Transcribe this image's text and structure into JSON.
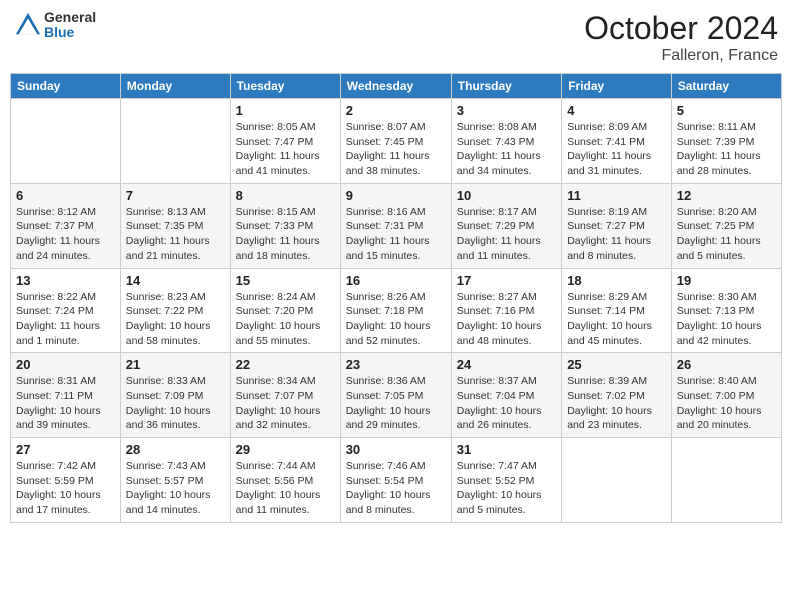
{
  "header": {
    "logo": {
      "general": "General",
      "blue": "Blue"
    },
    "title": "October 2024",
    "location": "Falleron, France"
  },
  "days_of_week": [
    "Sunday",
    "Monday",
    "Tuesday",
    "Wednesday",
    "Thursday",
    "Friday",
    "Saturday"
  ],
  "weeks": [
    [
      {
        "day": "",
        "sunrise": "",
        "sunset": "",
        "daylight": ""
      },
      {
        "day": "",
        "sunrise": "",
        "sunset": "",
        "daylight": ""
      },
      {
        "day": "1",
        "sunrise": "Sunrise: 8:05 AM",
        "sunset": "Sunset: 7:47 PM",
        "daylight": "Daylight: 11 hours and 41 minutes."
      },
      {
        "day": "2",
        "sunrise": "Sunrise: 8:07 AM",
        "sunset": "Sunset: 7:45 PM",
        "daylight": "Daylight: 11 hours and 38 minutes."
      },
      {
        "day": "3",
        "sunrise": "Sunrise: 8:08 AM",
        "sunset": "Sunset: 7:43 PM",
        "daylight": "Daylight: 11 hours and 34 minutes."
      },
      {
        "day": "4",
        "sunrise": "Sunrise: 8:09 AM",
        "sunset": "Sunset: 7:41 PM",
        "daylight": "Daylight: 11 hours and 31 minutes."
      },
      {
        "day": "5",
        "sunrise": "Sunrise: 8:11 AM",
        "sunset": "Sunset: 7:39 PM",
        "daylight": "Daylight: 11 hours and 28 minutes."
      }
    ],
    [
      {
        "day": "6",
        "sunrise": "Sunrise: 8:12 AM",
        "sunset": "Sunset: 7:37 PM",
        "daylight": "Daylight: 11 hours and 24 minutes."
      },
      {
        "day": "7",
        "sunrise": "Sunrise: 8:13 AM",
        "sunset": "Sunset: 7:35 PM",
        "daylight": "Daylight: 11 hours and 21 minutes."
      },
      {
        "day": "8",
        "sunrise": "Sunrise: 8:15 AM",
        "sunset": "Sunset: 7:33 PM",
        "daylight": "Daylight: 11 hours and 18 minutes."
      },
      {
        "day": "9",
        "sunrise": "Sunrise: 8:16 AM",
        "sunset": "Sunset: 7:31 PM",
        "daylight": "Daylight: 11 hours and 15 minutes."
      },
      {
        "day": "10",
        "sunrise": "Sunrise: 8:17 AM",
        "sunset": "Sunset: 7:29 PM",
        "daylight": "Daylight: 11 hours and 11 minutes."
      },
      {
        "day": "11",
        "sunrise": "Sunrise: 8:19 AM",
        "sunset": "Sunset: 7:27 PM",
        "daylight": "Daylight: 11 hours and 8 minutes."
      },
      {
        "day": "12",
        "sunrise": "Sunrise: 8:20 AM",
        "sunset": "Sunset: 7:25 PM",
        "daylight": "Daylight: 11 hours and 5 minutes."
      }
    ],
    [
      {
        "day": "13",
        "sunrise": "Sunrise: 8:22 AM",
        "sunset": "Sunset: 7:24 PM",
        "daylight": "Daylight: 11 hours and 1 minute."
      },
      {
        "day": "14",
        "sunrise": "Sunrise: 8:23 AM",
        "sunset": "Sunset: 7:22 PM",
        "daylight": "Daylight: 10 hours and 58 minutes."
      },
      {
        "day": "15",
        "sunrise": "Sunrise: 8:24 AM",
        "sunset": "Sunset: 7:20 PM",
        "daylight": "Daylight: 10 hours and 55 minutes."
      },
      {
        "day": "16",
        "sunrise": "Sunrise: 8:26 AM",
        "sunset": "Sunset: 7:18 PM",
        "daylight": "Daylight: 10 hours and 52 minutes."
      },
      {
        "day": "17",
        "sunrise": "Sunrise: 8:27 AM",
        "sunset": "Sunset: 7:16 PM",
        "daylight": "Daylight: 10 hours and 48 minutes."
      },
      {
        "day": "18",
        "sunrise": "Sunrise: 8:29 AM",
        "sunset": "Sunset: 7:14 PM",
        "daylight": "Daylight: 10 hours and 45 minutes."
      },
      {
        "day": "19",
        "sunrise": "Sunrise: 8:30 AM",
        "sunset": "Sunset: 7:13 PM",
        "daylight": "Daylight: 10 hours and 42 minutes."
      }
    ],
    [
      {
        "day": "20",
        "sunrise": "Sunrise: 8:31 AM",
        "sunset": "Sunset: 7:11 PM",
        "daylight": "Daylight: 10 hours and 39 minutes."
      },
      {
        "day": "21",
        "sunrise": "Sunrise: 8:33 AM",
        "sunset": "Sunset: 7:09 PM",
        "daylight": "Daylight: 10 hours and 36 minutes."
      },
      {
        "day": "22",
        "sunrise": "Sunrise: 8:34 AM",
        "sunset": "Sunset: 7:07 PM",
        "daylight": "Daylight: 10 hours and 32 minutes."
      },
      {
        "day": "23",
        "sunrise": "Sunrise: 8:36 AM",
        "sunset": "Sunset: 7:05 PM",
        "daylight": "Daylight: 10 hours and 29 minutes."
      },
      {
        "day": "24",
        "sunrise": "Sunrise: 8:37 AM",
        "sunset": "Sunset: 7:04 PM",
        "daylight": "Daylight: 10 hours and 26 minutes."
      },
      {
        "day": "25",
        "sunrise": "Sunrise: 8:39 AM",
        "sunset": "Sunset: 7:02 PM",
        "daylight": "Daylight: 10 hours and 23 minutes."
      },
      {
        "day": "26",
        "sunrise": "Sunrise: 8:40 AM",
        "sunset": "Sunset: 7:00 PM",
        "daylight": "Daylight: 10 hours and 20 minutes."
      }
    ],
    [
      {
        "day": "27",
        "sunrise": "Sunrise: 7:42 AM",
        "sunset": "Sunset: 5:59 PM",
        "daylight": "Daylight: 10 hours and 17 minutes."
      },
      {
        "day": "28",
        "sunrise": "Sunrise: 7:43 AM",
        "sunset": "Sunset: 5:57 PM",
        "daylight": "Daylight: 10 hours and 14 minutes."
      },
      {
        "day": "29",
        "sunrise": "Sunrise: 7:44 AM",
        "sunset": "Sunset: 5:56 PM",
        "daylight": "Daylight: 10 hours and 11 minutes."
      },
      {
        "day": "30",
        "sunrise": "Sunrise: 7:46 AM",
        "sunset": "Sunset: 5:54 PM",
        "daylight": "Daylight: 10 hours and 8 minutes."
      },
      {
        "day": "31",
        "sunrise": "Sunrise: 7:47 AM",
        "sunset": "Sunset: 5:52 PM",
        "daylight": "Daylight: 10 hours and 5 minutes."
      },
      {
        "day": "",
        "sunrise": "",
        "sunset": "",
        "daylight": ""
      },
      {
        "day": "",
        "sunrise": "",
        "sunset": "",
        "daylight": ""
      }
    ]
  ]
}
